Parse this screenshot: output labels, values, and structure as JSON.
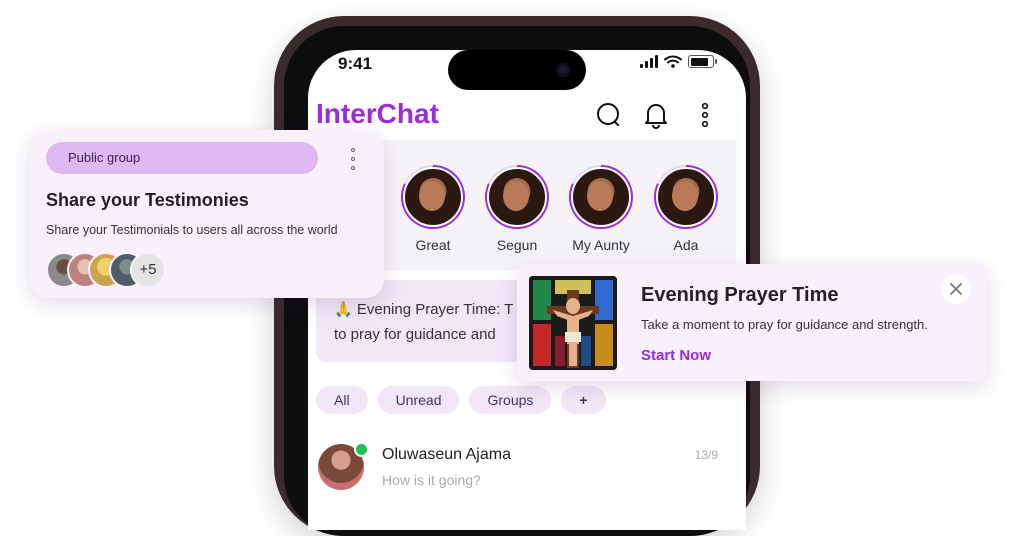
{
  "status_bar": {
    "time": "9:41"
  },
  "app": {
    "title": "InterChat",
    "accent": "#9c2bdc"
  },
  "header_icons": [
    "search-icon",
    "bell-icon",
    "more-vertical-icon"
  ],
  "stories": [
    {
      "label": "Great"
    },
    {
      "label": "Segun"
    },
    {
      "label": "My Aunty"
    },
    {
      "label": "Ada"
    }
  ],
  "prayer_strip": {
    "line1": "🙏 Evening Prayer Time: T",
    "line2": "to pray for guidance and"
  },
  "filters": [
    "All",
    "Unread",
    "Groups",
    "+"
  ],
  "chats": [
    {
      "name": "Oluwaseun Ajama",
      "preview": "How is it going?",
      "date": "13/9",
      "online": true
    }
  ],
  "group_card": {
    "tag": "Public group",
    "title": "Share your Testimonies",
    "description": "Share your Testimonials to users all across the world",
    "more_members": "+5"
  },
  "prayer_card": {
    "title": "Evening Prayer Time",
    "subtitle": "Take a moment to pray for guidance and strength.",
    "cta": "Start Now"
  }
}
